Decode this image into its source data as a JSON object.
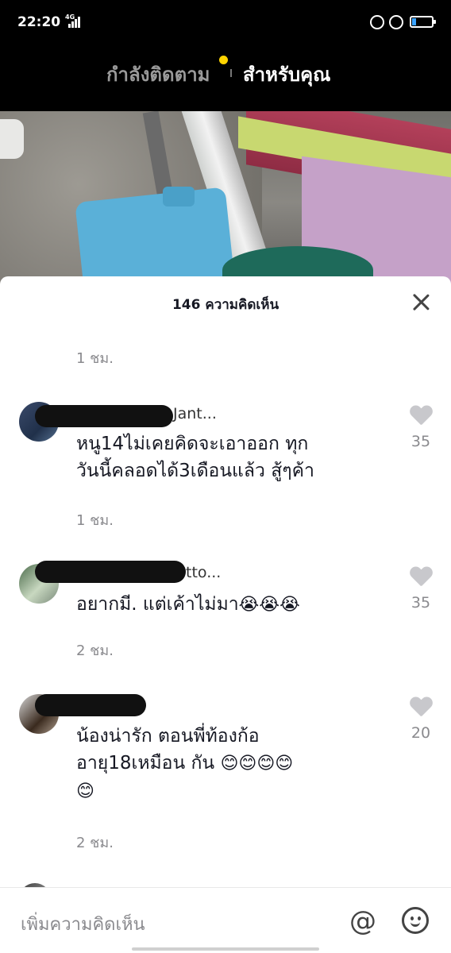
{
  "status_bar": {
    "time": "22:20",
    "network": "4G",
    "icons": [
      "lock-rotation-icon",
      "alarm-icon",
      "battery-icon"
    ],
    "battery_color": "#3aa3ff"
  },
  "top_tabs": {
    "following": "กำลังติดตาม",
    "for_you": "สำหรับคุณ",
    "dot_color": "#ffd400"
  },
  "comments_panel": {
    "title": "146 ความคิดเห็น",
    "first_time": "1 ชม.",
    "comments": [
      {
        "username": "Jant...",
        "text_lines": [
          "หนู14ไม่เคยคิดจะเอาออก ทุก",
          "วันนี้คลอดได้3เดือนแล้ว สู้ๆค้า"
        ],
        "likes": "35",
        "time": "1 ชม."
      },
      {
        "username": "tto...",
        "text": "อยากมี. แต่เค้าไม่มา",
        "emojis": "😭😭😭",
        "likes": "35",
        "time": "2 ชม."
      },
      {
        "username": "",
        "text_lines": [
          "น้องน่ารัก  ตอนพี่ท้องก้อ",
          "อายุ18เหมือน กัน"
        ],
        "emojis_line2": "😊😊😊😊",
        "emojis_line3": "😊",
        "likes": "20",
        "time": "2 ชม."
      }
    ]
  },
  "input_bar": {
    "placeholder": "เพิ่มความคิดเห็น",
    "mention_symbol": "@"
  }
}
